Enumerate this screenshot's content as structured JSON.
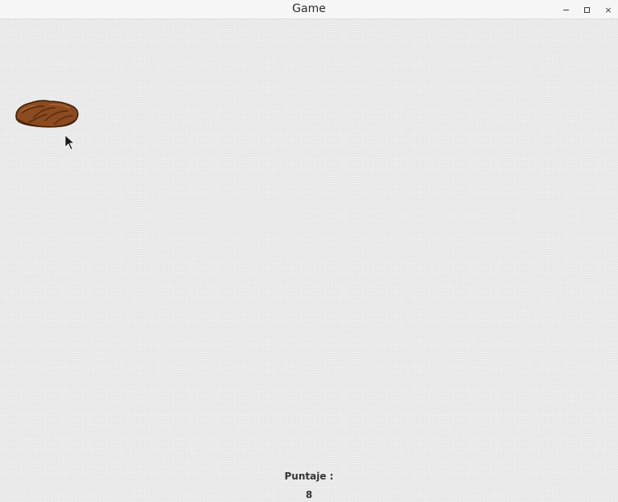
{
  "window": {
    "title": "Game",
    "controls": {
      "minimize_icon": "minimize-icon",
      "maximize_icon": "maximize-icon",
      "close_icon": "close-icon",
      "close_glyph": "×"
    }
  },
  "game": {
    "score_label": "Puntaje :",
    "score_value": "8",
    "sprite_icon": "cookie-icon",
    "sprite_color": "#8b4a1f",
    "background_color": "#ececec"
  }
}
